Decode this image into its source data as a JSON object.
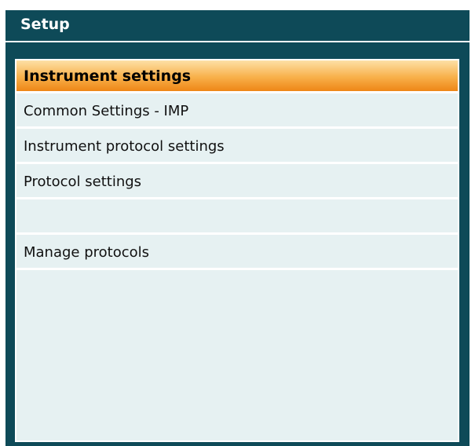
{
  "window": {
    "title": "Setup"
  },
  "menu": {
    "items": [
      {
        "label": "Instrument settings",
        "selected": true
      },
      {
        "label": "Common Settings - IMP",
        "selected": false
      },
      {
        "label": "Instrument protocol settings",
        "selected": false
      },
      {
        "label": "Protocol settings",
        "selected": false
      },
      {
        "label": "",
        "selected": false
      },
      {
        "label": "Manage protocols",
        "selected": false
      }
    ]
  },
  "colors": {
    "frame": "#0e4a58",
    "panel": "#e6f1f2",
    "selected_top": "#fde0a6",
    "selected_bottom": "#ee8616"
  }
}
